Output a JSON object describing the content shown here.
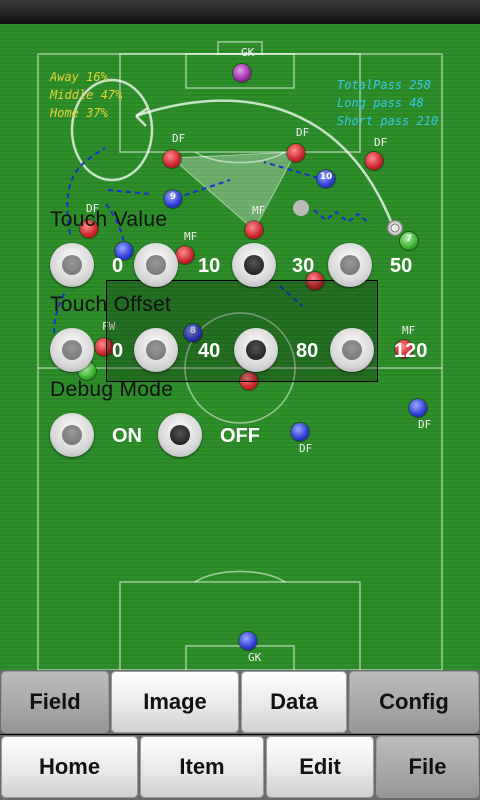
{
  "field": {
    "stats_left": [
      "Away 16%",
      "Middle 47%",
      "Home 37%"
    ],
    "stats_right": [
      "TotalPass 258",
      "Long pass 48",
      "Short pass 210"
    ],
    "players": [
      {
        "team": "top-gk",
        "number": "",
        "role": "GK"
      },
      {
        "team": "red",
        "number": "",
        "role": "DF"
      },
      {
        "team": "red",
        "number": "",
        "role": "DF"
      },
      {
        "team": "red",
        "number": "",
        "role": "DF"
      },
      {
        "team": "red",
        "number": "",
        "role": "DF"
      },
      {
        "team": "red",
        "number": "",
        "role": "MF"
      },
      {
        "team": "red",
        "number": "",
        "role": "MF"
      },
      {
        "team": "red",
        "number": "",
        "role": "FW"
      },
      {
        "team": "red",
        "number": "",
        "role": "MF"
      },
      {
        "team": "blue",
        "number": "9",
        "role": ""
      },
      {
        "team": "blue",
        "number": "10",
        "role": ""
      },
      {
        "team": "blue",
        "number": "8",
        "role": ""
      },
      {
        "team": "blue",
        "number": "",
        "role": "DF"
      },
      {
        "team": "blue",
        "number": "",
        "role": "DF"
      },
      {
        "team": "blue",
        "number": "",
        "role": "GK"
      },
      {
        "team": "green",
        "number": "7",
        "role": ""
      }
    ]
  },
  "settings": {
    "touch_value": {
      "label": "Touch Value",
      "options": [
        "0",
        "10",
        "30",
        "50"
      ],
      "selected": "30"
    },
    "touch_offset": {
      "label": "Touch Offset",
      "options": [
        "0",
        "40",
        "80",
        "120"
      ],
      "selected": "80"
    },
    "debug_mode": {
      "label": "Debug Mode",
      "options": [
        "ON",
        "OFF"
      ],
      "selected": "OFF"
    }
  },
  "tabs_top": [
    {
      "label": "Field",
      "selected": true
    },
    {
      "label": "Image",
      "selected": false
    },
    {
      "label": "Data",
      "selected": false
    },
    {
      "label": "Config",
      "selected": true
    }
  ],
  "tabs_bottom": [
    {
      "label": "Home",
      "selected": false
    },
    {
      "label": "Item",
      "selected": false
    },
    {
      "label": "Edit",
      "selected": false
    },
    {
      "label": "File",
      "selected": true
    }
  ],
  "colors": {
    "red_team": "#c8222a",
    "blue_team": "#2b3bd1",
    "pitch": "#2f8f2b",
    "stats_left": "#e8d13a",
    "stats_right": "#35c8e8"
  }
}
